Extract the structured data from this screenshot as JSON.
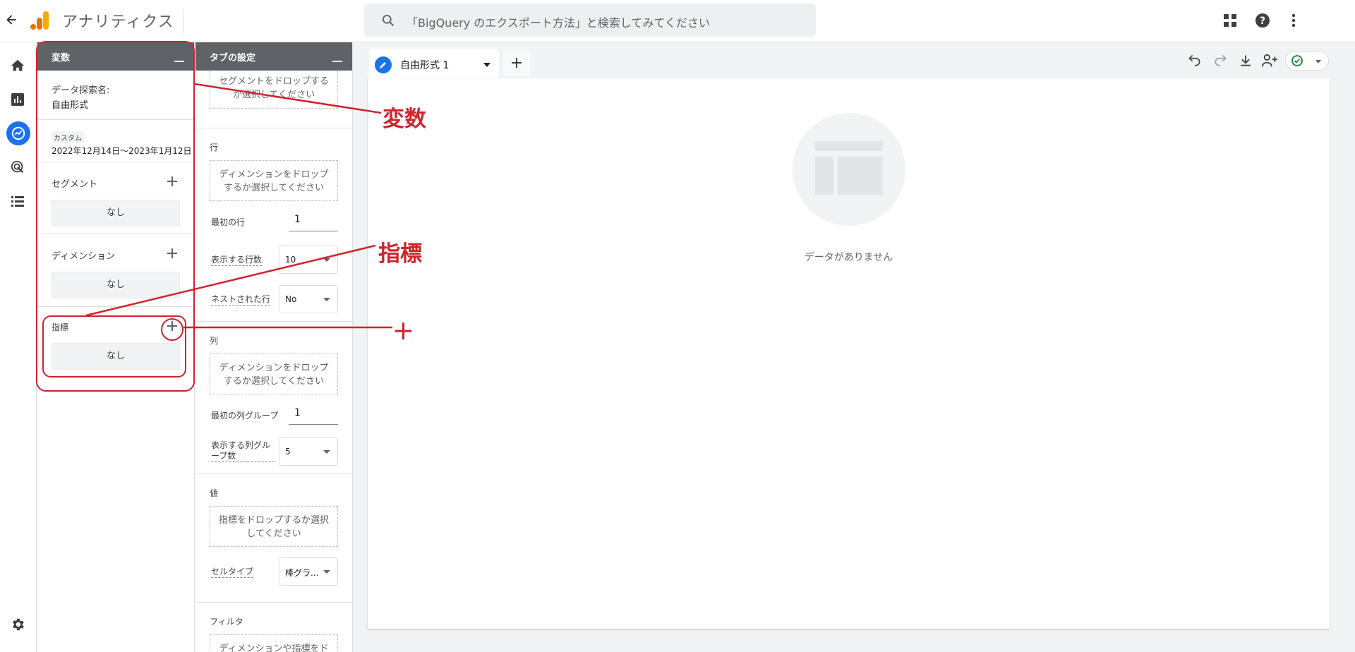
{
  "header": {
    "app_title": "アナリティクス",
    "search_placeholder": "「BigQuery のエクスポート方法」と検索してみてください"
  },
  "variables_panel": {
    "title": "変数",
    "exploration_name_label": "データ探索名:",
    "exploration_name_value": "自由形式",
    "date_chip": "カスタム",
    "date_range": "2022年12月14日～2023年1月12日",
    "segments_title": "セグメント",
    "segments_none": "なし",
    "dimensions_title": "ディメンション",
    "dimensions_none": "なし",
    "metrics_title": "指標",
    "metrics_none": "なし"
  },
  "tab_settings_panel": {
    "title": "タブの設定",
    "segment_drop": "セグメントをドロップする か選択してください",
    "rows_title": "行",
    "rows_drop": "ディメンションをドロップ するか選択してください",
    "first_row_label": "最初の行",
    "first_row_value": "1",
    "rows_shown_label": "表示する行数",
    "rows_shown_value": "10",
    "nested_rows_label": "ネストされた行",
    "nested_rows_value": "No",
    "columns_title": "列",
    "columns_drop": "ディメンションをドロップ するか選択してください",
    "first_col_group_label": "最初の列グループ",
    "first_col_group_value": "1",
    "col_groups_shown_label": "表示する列グル ープ数",
    "col_groups_shown_value": "5",
    "values_title": "値",
    "values_drop": "指標をドロップするか選択 してください",
    "cell_type_label": "セルタイプ",
    "cell_type_value": "棒グラ...",
    "filters_title": "フィルタ",
    "filters_drop": "ディメンションや指標をド"
  },
  "canvas": {
    "tab_label": "自由形式 1",
    "empty_message": "データがありません"
  },
  "annotations": {
    "variables": "変数",
    "metrics": "指標",
    "plus": "＋"
  },
  "colors": {
    "accent": "#1a73e8",
    "annotation": "#d0232b",
    "panel_header": "#5f6368"
  }
}
